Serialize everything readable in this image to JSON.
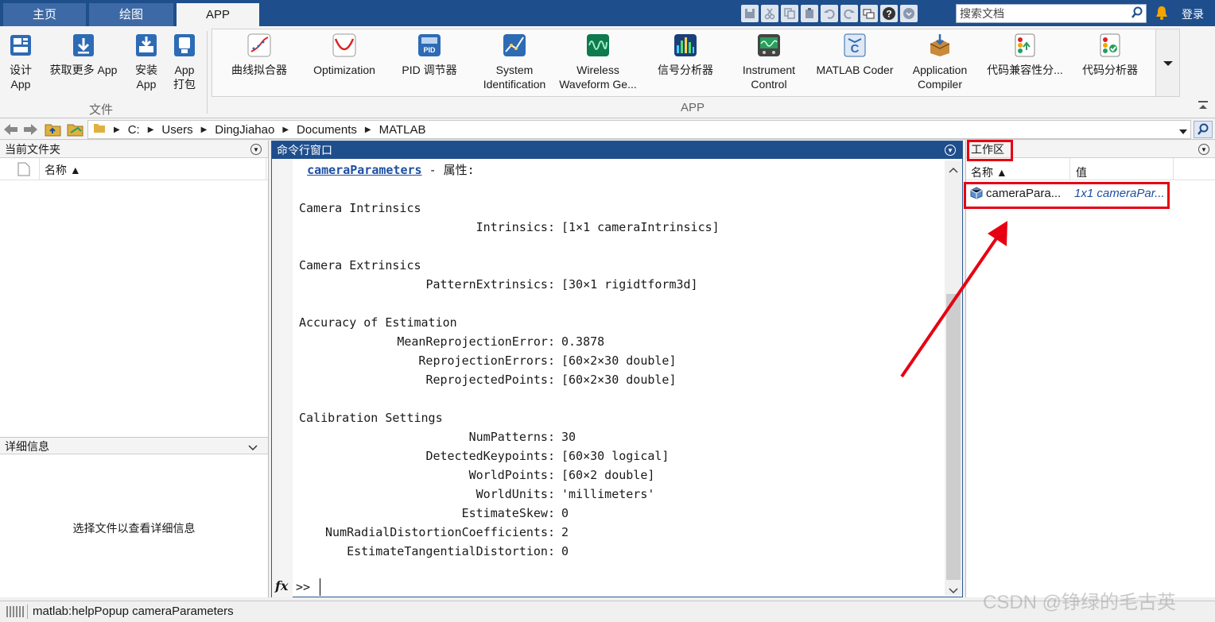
{
  "tabs": [
    {
      "label": "主页"
    },
    {
      "label": "绘图"
    },
    {
      "label": "APP"
    }
  ],
  "search": {
    "placeholder": "搜索文档"
  },
  "login": "登录",
  "ribbon": {
    "file_section": {
      "label": "文件",
      "buttons": [
        {
          "line1": "设计",
          "line2": "App"
        },
        {
          "line1": "获取更多 App",
          "line2": ""
        },
        {
          "line1": "安装",
          "line2": "App"
        },
        {
          "line1": "App",
          "line2": "打包"
        }
      ]
    },
    "app_section": {
      "label": "APP",
      "apps": [
        {
          "line1": "曲线拟合器",
          "line2": ""
        },
        {
          "line1": "Optimization",
          "line2": ""
        },
        {
          "line1": "PID 调节器",
          "line2": ""
        },
        {
          "line1": "System",
          "line2": "Identification"
        },
        {
          "line1": "Wireless",
          "line2": "Waveform Ge..."
        },
        {
          "line1": "信号分析器",
          "line2": ""
        },
        {
          "line1": "Instrument",
          "line2": "Control"
        },
        {
          "line1": "MATLAB Coder",
          "line2": ""
        },
        {
          "line1": "Application",
          "line2": "Compiler"
        },
        {
          "line1": "代码兼容性分...",
          "line2": ""
        },
        {
          "line1": "代码分析器",
          "line2": ""
        }
      ]
    }
  },
  "address": {
    "crumbs": [
      "C:",
      "Users",
      "DingJiahao",
      "Documents",
      "MATLAB"
    ]
  },
  "current_folder": {
    "title": "当前文件夹",
    "column_name": "名称 ▲"
  },
  "details": {
    "title": "详细信息",
    "message": "选择文件以查看详细信息"
  },
  "command_window": {
    "title": "命令行窗口",
    "link": "cameraParameters",
    "link_suffix": " - 属性:",
    "sections": [
      {
        "header": "Camera Intrinsics",
        "props": [
          {
            "key": "Intrinsics:",
            "value": "[1×1 cameraIntrinsics]"
          }
        ]
      },
      {
        "header": "Camera Extrinsics",
        "props": [
          {
            "key": "PatternExtrinsics:",
            "value": "[30×1 rigidtform3d]"
          }
        ]
      },
      {
        "header": "Accuracy of Estimation",
        "props": [
          {
            "key": "MeanReprojectionError:",
            "value": "0.3878"
          },
          {
            "key": "ReprojectionErrors:",
            "value": "[60×2×30 double]"
          },
          {
            "key": "ReprojectedPoints:",
            "value": "[60×2×30 double]"
          }
        ]
      },
      {
        "header": "Calibration Settings",
        "props": [
          {
            "key": "NumPatterns:",
            "value": "30"
          },
          {
            "key": "DetectedKeypoints:",
            "value": "[60×30 logical]"
          },
          {
            "key": "WorldPoints:",
            "value": "[60×2 double]"
          },
          {
            "key": "WorldUnits:",
            "value": "'millimeters'"
          },
          {
            "key": "EstimateSkew:",
            "value": "0"
          },
          {
            "key": "NumRadialDistortionCoefficients:",
            "value": "2"
          },
          {
            "key": "EstimateTangentialDistortion:",
            "value": "0"
          }
        ]
      }
    ],
    "fx": "fx",
    "prompt": ">>"
  },
  "workspace": {
    "title": "工作区",
    "col_name": "名称 ▲",
    "col_value": "值",
    "rows": [
      {
        "name": "cameraPara...",
        "value": "1x1 cameraPar..."
      }
    ]
  },
  "status": {
    "text": "matlab:helpPopup cameraParameters"
  },
  "watermark": "CSDN @铮绿的毛古英",
  "colors": {
    "title_blue": "#1f4e8c",
    "highlight_red": "#e60012",
    "link_blue": "#1e4fa0"
  }
}
